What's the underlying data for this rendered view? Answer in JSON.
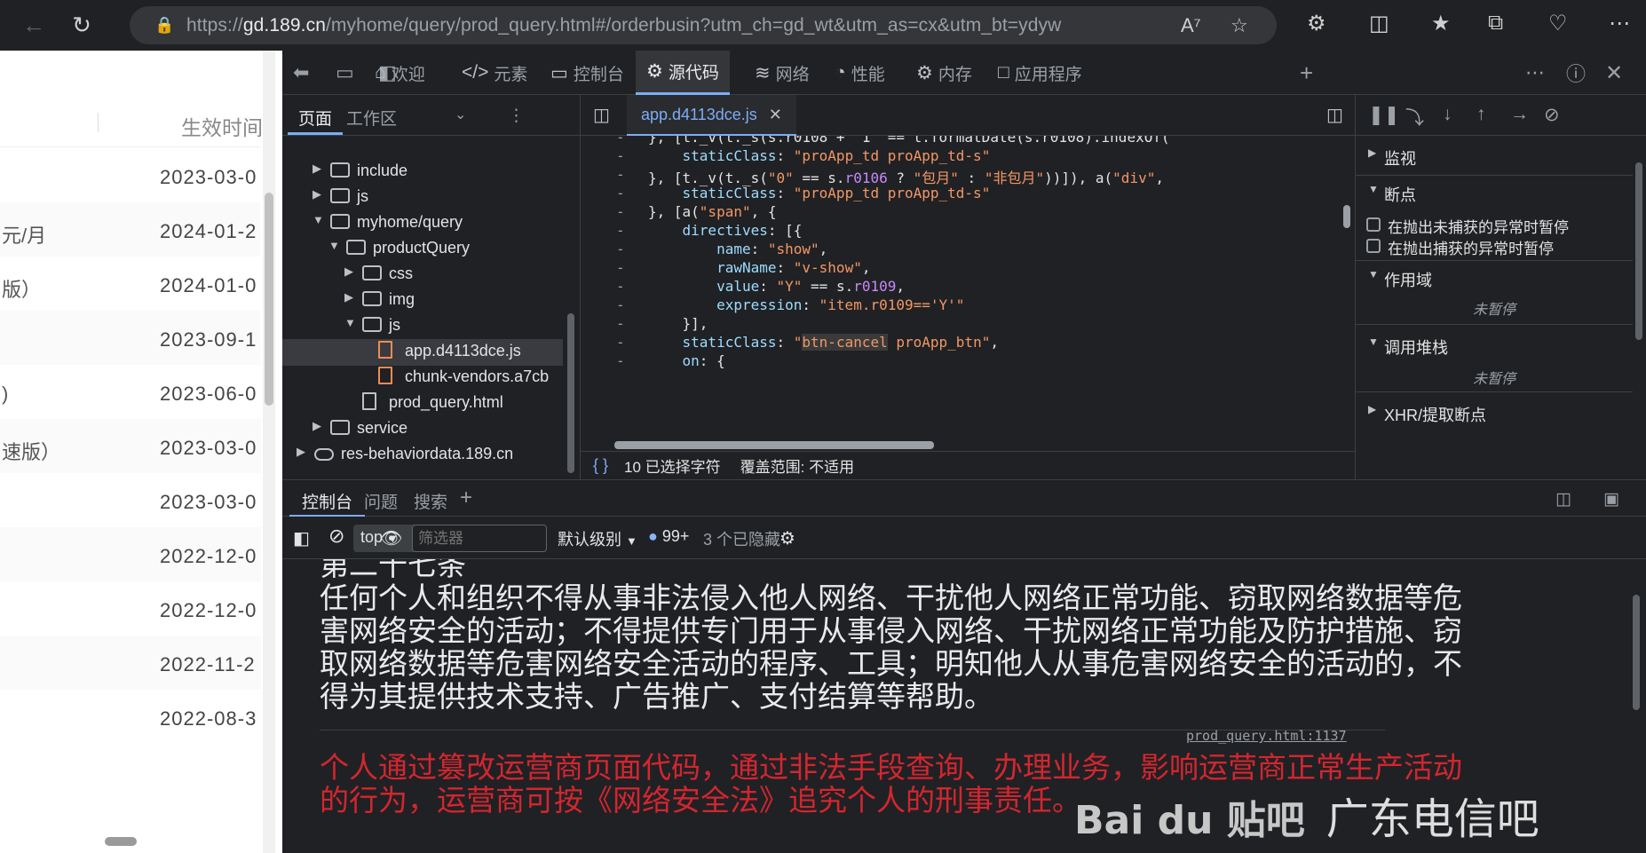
{
  "browser": {
    "url_prefix": "https://",
    "url_host": "gd.189.cn",
    "url_path": "/myhome/query/prod_query.html#/orderbusin?utm_ch=gd_wt&utm_as=cx&utm_bt=ydyw"
  },
  "webpage": {
    "column_header": "生效时间",
    "rows": [
      {
        "left": "",
        "date": "2023-03-0"
      },
      {
        "left": "元/月",
        "date": "2024-01-2"
      },
      {
        "left": "版）",
        "date": "2024-01-0"
      },
      {
        "left": "",
        "date": "2023-09-1"
      },
      {
        "left": ")",
        "date": "2023-06-0"
      },
      {
        "left": "速版）",
        "date": "2023-03-0"
      },
      {
        "left": "",
        "date": "2023-03-0"
      },
      {
        "left": "",
        "date": "2022-12-0"
      },
      {
        "left": "",
        "date": "2022-12-0"
      },
      {
        "left": "",
        "date": "2022-11-2"
      },
      {
        "left": "",
        "date": "2022-08-3"
      }
    ]
  },
  "devtools": {
    "tabs": [
      {
        "label": "欢迎",
        "icon": "home-icon"
      },
      {
        "label": "元素",
        "icon": "code-icon"
      },
      {
        "label": "控制台",
        "icon": "console-icon"
      },
      {
        "label": "源代码",
        "icon": "bug-icon"
      },
      {
        "label": "网络",
        "icon": "wifi-icon"
      },
      {
        "label": "性能",
        "icon": "gauge-icon"
      },
      {
        "label": "内存",
        "icon": "memory-icon"
      },
      {
        "label": "应用程序",
        "icon": "window-icon"
      }
    ],
    "navigator": {
      "tabs": [
        "页面",
        "工作区"
      ],
      "tree": [
        {
          "label": "include",
          "type": "folder",
          "depth": 2,
          "expanded": false
        },
        {
          "label": "js",
          "type": "folder",
          "depth": 2,
          "expanded": false
        },
        {
          "label": "myhome/query",
          "type": "folder",
          "depth": 2,
          "expanded": true
        },
        {
          "label": "productQuery",
          "type": "folder",
          "depth": 3,
          "expanded": true
        },
        {
          "label": "css",
          "type": "folder",
          "depth": 4,
          "expanded": false
        },
        {
          "label": "img",
          "type": "folder",
          "depth": 4,
          "expanded": false
        },
        {
          "label": "js",
          "type": "folder",
          "depth": 4,
          "expanded": true
        },
        {
          "label": "app.d4113dce.js",
          "type": "jsfile",
          "depth": 5,
          "selected": true
        },
        {
          "label": "chunk-vendors.a7cb",
          "type": "jsfile",
          "depth": 5
        },
        {
          "label": "prod_query.html",
          "type": "file",
          "depth": 4
        },
        {
          "label": "service",
          "type": "folder",
          "depth": 2,
          "expanded": false
        },
        {
          "label": "res-behaviordata.189.cn",
          "type": "cloud",
          "depth": 1,
          "expanded": false
        }
      ]
    },
    "editor": {
      "tab_label": "app.d4113dce.js",
      "status_selection": "10 已选择字符",
      "status_coverage": "覆盖范围: 不适用"
    },
    "debugger": {
      "watch": "监视",
      "breakpoints": "断点",
      "pause_uncaught": "在抛出未捕获的异常时暂停",
      "pause_caught": "在抛出捕获的异常时暂停",
      "scope": "作用域",
      "not_paused_1": "未暂停",
      "call_stack": "调用堆栈",
      "not_paused_2": "未暂停",
      "xhr_breakpoints": "XHR/提取断点"
    },
    "drawer": {
      "tabs": [
        "控制台",
        "问题",
        "搜索"
      ],
      "context": "top",
      "filter_placeholder": "筛选器",
      "level": "默认级别",
      "message_count": "99+",
      "hidden": "3 个已隐藏"
    },
    "console": {
      "heading": "第二十七条",
      "body": [
        "任何个人和组织不得从事非法侵入他人网络、干扰他人网络正常功能、窃取网络数据等危",
        "害网络安全的活动；不得提供专门用于从事侵入网络、干扰网络正常功能及防护措施、窃",
        "取网络数据等危害网络安全活动的程序、工具；明知他人从事危害网络安全的活动的，不",
        "得为其提供技术支持、广告推广、支付结算等帮助。"
      ],
      "source_link": "prod_query.html:1137",
      "warning": [
        "个人通过篡改运营商页面代码，通过非法手段查询、办理业务，影响运营商正常生产活动",
        "的行为，运营商可按《网络安全法》追究个人的刑事责任。"
      ]
    },
    "watermark": {
      "logo_text": "Bai du 贴吧",
      "text": "广东电信吧"
    }
  }
}
